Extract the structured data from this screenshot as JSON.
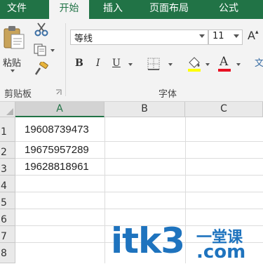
{
  "ribbon_tabs": [
    {
      "label": "文件"
    },
    {
      "label": "开始",
      "active": true
    },
    {
      "label": "插入"
    },
    {
      "label": "页面布局"
    },
    {
      "label": "公式"
    }
  ],
  "clipboard": {
    "paste_label": "粘贴",
    "group_label": "剪贴板"
  },
  "font": {
    "font_name": "等线",
    "font_size": "11",
    "grow_label": "A",
    "bold_label": "B",
    "italic_label": "I",
    "underline_label": "U",
    "group_label": "字体",
    "highlight_color": "#ffff00",
    "font_color": "#e81123"
  },
  "sheet": {
    "columns": [
      "A",
      "B",
      "C"
    ],
    "rows": [
      "1",
      "2",
      "3",
      "4",
      "5",
      "6",
      "7",
      "8"
    ],
    "cells": {
      "A1": "19608739473",
      "A2": "19675957289",
      "A3": "19628818961"
    }
  },
  "watermark": {
    "domain_text": "itk3",
    "dot_com": ".com",
    "cn_text": "一堂课"
  },
  "colors": {
    "brand_green": "#217346",
    "watermark_blue": "#1e73be"
  }
}
